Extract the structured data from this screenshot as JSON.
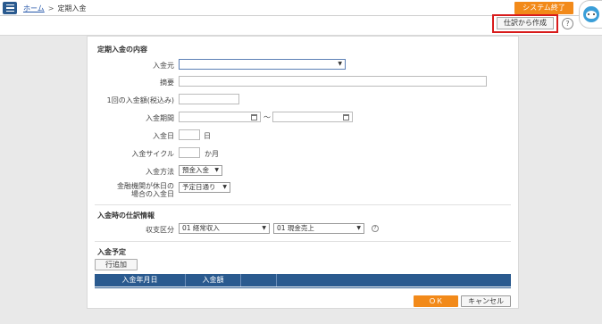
{
  "header": {
    "home_link": "ホーム",
    "separator": ">",
    "page_name": "定期入金",
    "system_exit": "システム終了",
    "create_from_journal": "仕訳から作成",
    "help_symbol": "?"
  },
  "section1": {
    "title": "定期入金の内容",
    "fields": {
      "source_label": "入金元",
      "source_value": "",
      "summary_label": "摘要",
      "amount_label": "1回の入金額(税込み)",
      "period_label": "入金期間",
      "period_sep": "〜",
      "day_label": "入金日",
      "day_unit": "日",
      "cycle_label": "入金サイクル",
      "cycle_unit": "か月",
      "method_label": "入金方法",
      "method_value": "預金入金",
      "holiday_label_line1": "金融機関が休日の",
      "holiday_label_line2": "場合の入金日",
      "holiday_value": "予定日通り"
    }
  },
  "section2": {
    "title": "入金時の仕訳情報",
    "category_label": "収支区分",
    "category_value": "01 経常収入",
    "subcategory_value": "01 現金売上",
    "help_symbol": "?"
  },
  "section3": {
    "title": "入金予定",
    "add_row": "行追加",
    "columns": [
      "入金年月日",
      "入金額"
    ]
  },
  "footer": {
    "ok": "ＯＫ",
    "cancel": "キャンセル"
  },
  "colors": {
    "accent_orange": "#f28a1a",
    "nav_blue": "#2a5a8f",
    "highlight_red": "#d81b1b"
  },
  "icons": [
    "menu-icon",
    "help-icon",
    "avatar-icon",
    "calendar-icon",
    "dropdown-arrow-icon"
  ]
}
